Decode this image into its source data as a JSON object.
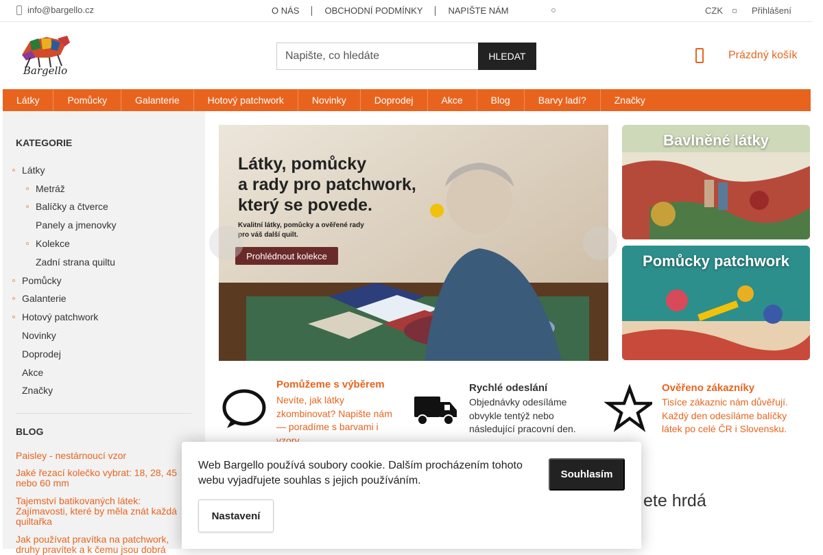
{
  "topbar": {
    "email": "info@bargello.cz",
    "nav": [
      "O NÁS",
      "OBCHODNÍ PODMÍNKY",
      "NAPIŠTE NÁM"
    ],
    "currency": "CZK",
    "login": "Přihlášení"
  },
  "header": {
    "logo_text": "Bargello",
    "search_placeholder": "Napište, co hledáte",
    "search_button": "HLEDAT",
    "cart_label": "Prázdný košík"
  },
  "menu": [
    "Látky",
    "Pomůcky",
    "Galanterie",
    "Hotový patchwork",
    "Novinky",
    "Doprodej",
    "Akce",
    "Blog",
    "Barvy ladí?",
    "Značky"
  ],
  "sidebar": {
    "categories_title": "KATEGORIE",
    "categories": [
      {
        "label": "Látky",
        "level": 0,
        "bullet": true
      },
      {
        "label": "Metráž",
        "level": 1,
        "bullet": true
      },
      {
        "label": "Balíčky a čtverce",
        "level": 1,
        "bullet": true
      },
      {
        "label": "Panely a jmenovky",
        "level": 1,
        "bullet": false
      },
      {
        "label": "Kolekce",
        "level": 1,
        "bullet": true
      },
      {
        "label": "Zadní strana quiltu",
        "level": 1,
        "bullet": false
      },
      {
        "label": "Pomůcky",
        "level": 0,
        "bullet": true
      },
      {
        "label": "Galanterie",
        "level": 0,
        "bullet": true
      },
      {
        "label": "Hotový patchwork",
        "level": 0,
        "bullet": true
      },
      {
        "label": "Novinky",
        "level": 0,
        "bullet": false
      },
      {
        "label": "Doprodej",
        "level": 0,
        "bullet": false
      },
      {
        "label": "Akce",
        "level": 0,
        "bullet": false
      },
      {
        "label": "Značky",
        "level": 0,
        "bullet": false
      }
    ],
    "blog_title": "BLOG",
    "blog_posts": [
      "Paisley - nestárnoucí vzor",
      "Jaké řezací kolečko vybrat: 18, 28, 45 nebo 60 mm",
      "Tajemství batikovaných látek: Zajímavosti, které by měla znát každá quiltařka",
      "Jak používat pravítka na patchwork, druhy pravítek a k čemu jsou dobrá"
    ]
  },
  "hero": {
    "title_line1": "Látky, pomůcky",
    "title_line2": "a rady pro patchwork,",
    "title_line3": "který se povede.",
    "subtitle": "Kvalitní látky, pomůcky a ověřené rady pro váš další quilt.",
    "cta": "Prohlédnout kolekce"
  },
  "side_banners": [
    "Bavlněné látky",
    "Pomůcky patchwork"
  ],
  "benefits": [
    {
      "title": "Pomůžeme s výběrem",
      "text": "Nevíte, jak látky zkombinovat? Napište nám — poradíme s barvami i vzory.",
      "icon": "chat-bubble-icon"
    },
    {
      "title": "Rychlé odeslání",
      "text": "Objednávky odesíláme obvykle tentýž nebo následující pracovní den.",
      "icon": "truck-icon"
    },
    {
      "title": "Ověřeno zákazníky",
      "text": "Tisíce zákaznic nám důvěřují. Každý den odesíláme balíčky látek po celé ČR i Slovensku.",
      "icon": "star-icon"
    }
  ],
  "partial_heading": "ete hrdá",
  "cookie": {
    "text": "Web Bargello používá soubory cookie. Dalším procházením tohoto webu vyjadřujete souhlas s jejich používáním.",
    "agree": "Souhlasím",
    "settings": "Nastavení"
  },
  "colors": {
    "accent": "#e8641e",
    "dark": "#222222",
    "sidebar_bg": "#f2f2f2"
  }
}
